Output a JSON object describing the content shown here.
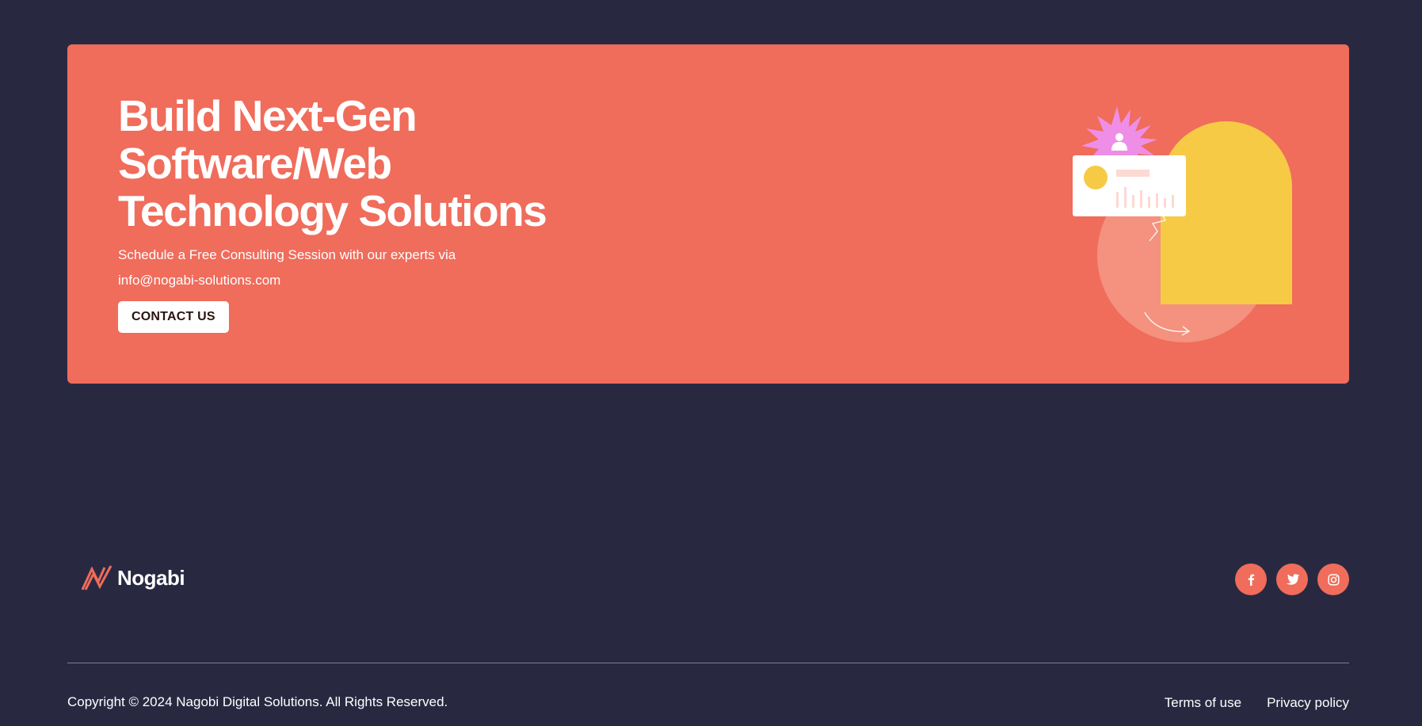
{
  "cta": {
    "title_line1": "Build Next-Gen",
    "title_line2": "Software/Web",
    "title_line3": "Technology Solutions",
    "subtitle": "Schedule a Free Consulting Session with our experts via",
    "email": "info@nogabi-solutions.com",
    "button_label": "CONTACT US"
  },
  "footer": {
    "logo_text": "Nogabi",
    "social": [
      {
        "icon": "facebook-icon"
      },
      {
        "icon": "twitter-icon"
      },
      {
        "icon": "instagram-icon"
      }
    ],
    "copyright": "Copyright © 2024 Nagobi Digital Solutions. All Rights Reserved.",
    "links": [
      {
        "label": "Terms of use"
      },
      {
        "label": "Privacy policy"
      }
    ]
  },
  "colors": {
    "background": "#282941",
    "accent": "#f06c5b",
    "yellow": "#f7ca45",
    "pink": "#ef8ee6"
  }
}
